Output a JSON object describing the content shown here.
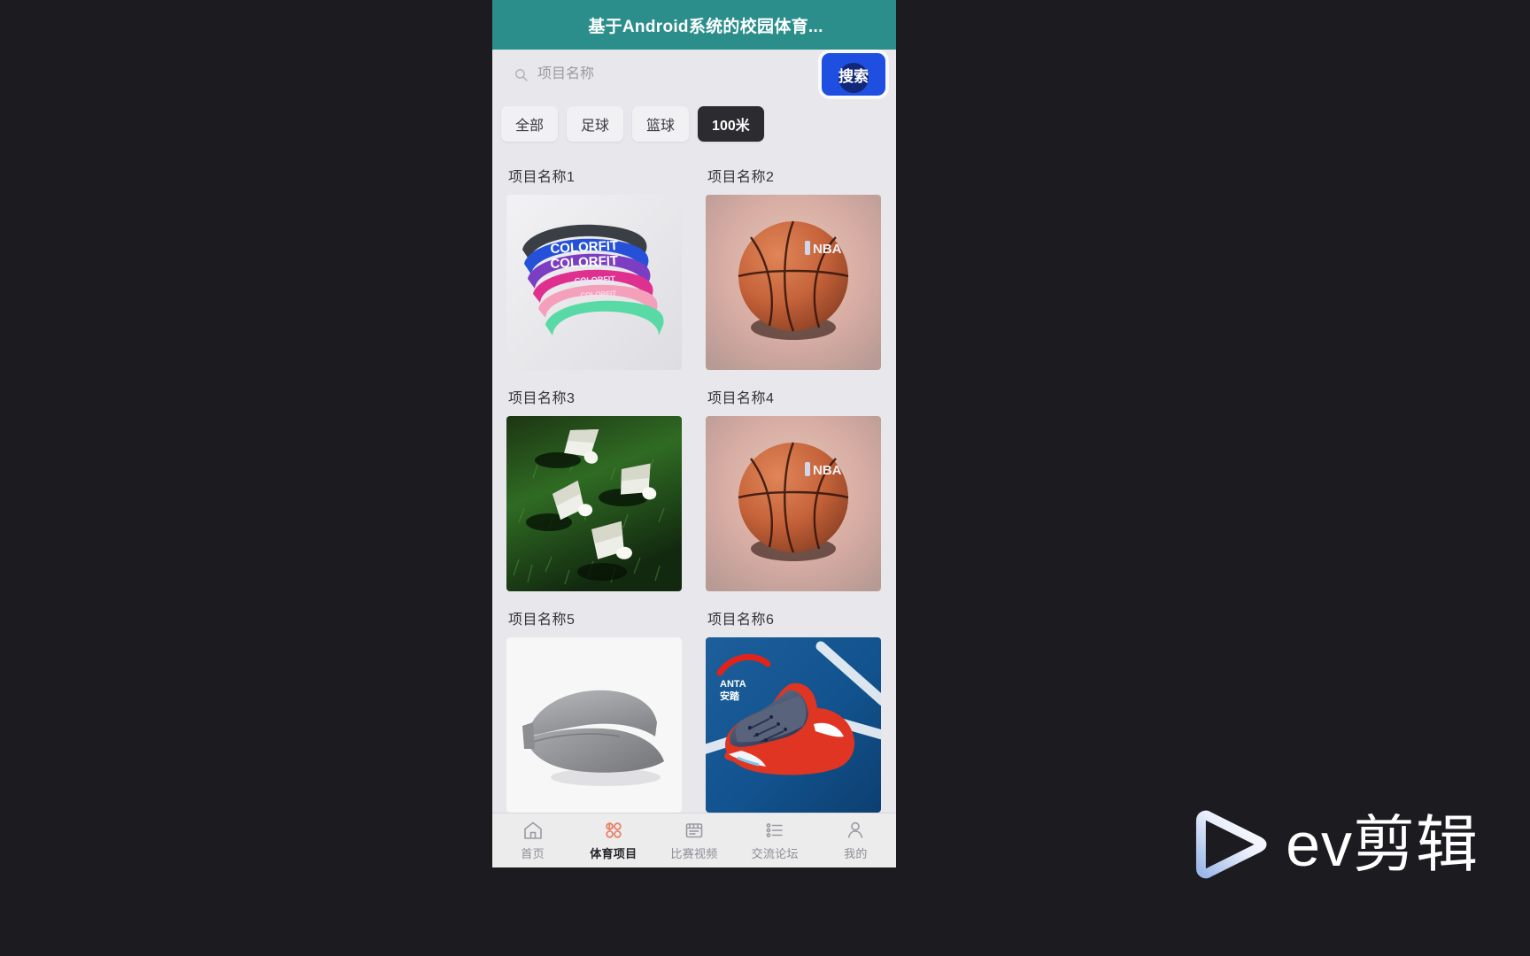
{
  "window": {
    "background_color": "#1b1b20"
  },
  "header": {
    "title": "基于Android系统的校园体育...",
    "background_color": "#2b8e8b",
    "text_color": "#ffffff"
  },
  "search": {
    "icon": "search-icon",
    "placeholder": "项目名称",
    "value": "",
    "button_label": "搜索",
    "button_color": "#1f4fe0"
  },
  "filters": {
    "chips": [
      {
        "label": "全部",
        "active": false
      },
      {
        "label": "足球",
        "active": false
      },
      {
        "label": "篮球",
        "active": false
      },
      {
        "label": "100米",
        "active": true
      }
    ],
    "active_color": "#2b2b30"
  },
  "grid": {
    "items": [
      {
        "title": "项目名称1",
        "image": "resistance-bands-colorfit",
        "image_caption": "COLORFIT"
      },
      {
        "title": "项目名称2",
        "image": "basketball-nba",
        "image_caption": "NBA"
      },
      {
        "title": "项目名称3",
        "image": "shuttlecocks-on-grass",
        "image_caption": ""
      },
      {
        "title": "项目名称4",
        "image": "basketball-nba",
        "image_caption": "NBA"
      },
      {
        "title": "项目名称5",
        "image": "gray-sun-visor-cap",
        "image_caption": ""
      },
      {
        "title": "项目名称6",
        "image": "anta-basketball-shoe",
        "image_caption": "ANTA 安踏"
      }
    ]
  },
  "tabbar": {
    "items": [
      {
        "label": "首页",
        "icon": "home-icon",
        "active": false
      },
      {
        "label": "体育项目",
        "icon": "grid-petals-icon",
        "active": true
      },
      {
        "label": "比赛视频",
        "icon": "video-board-icon",
        "active": false
      },
      {
        "label": "交流论坛",
        "icon": "list-icon",
        "active": false
      },
      {
        "label": "我的",
        "icon": "person-icon",
        "active": false
      }
    ],
    "active_icon_color": "#e8836b",
    "inactive_color": "#8d8d96"
  },
  "watermark": {
    "text": "ev剪辑",
    "icon": "play-triangle-icon"
  }
}
